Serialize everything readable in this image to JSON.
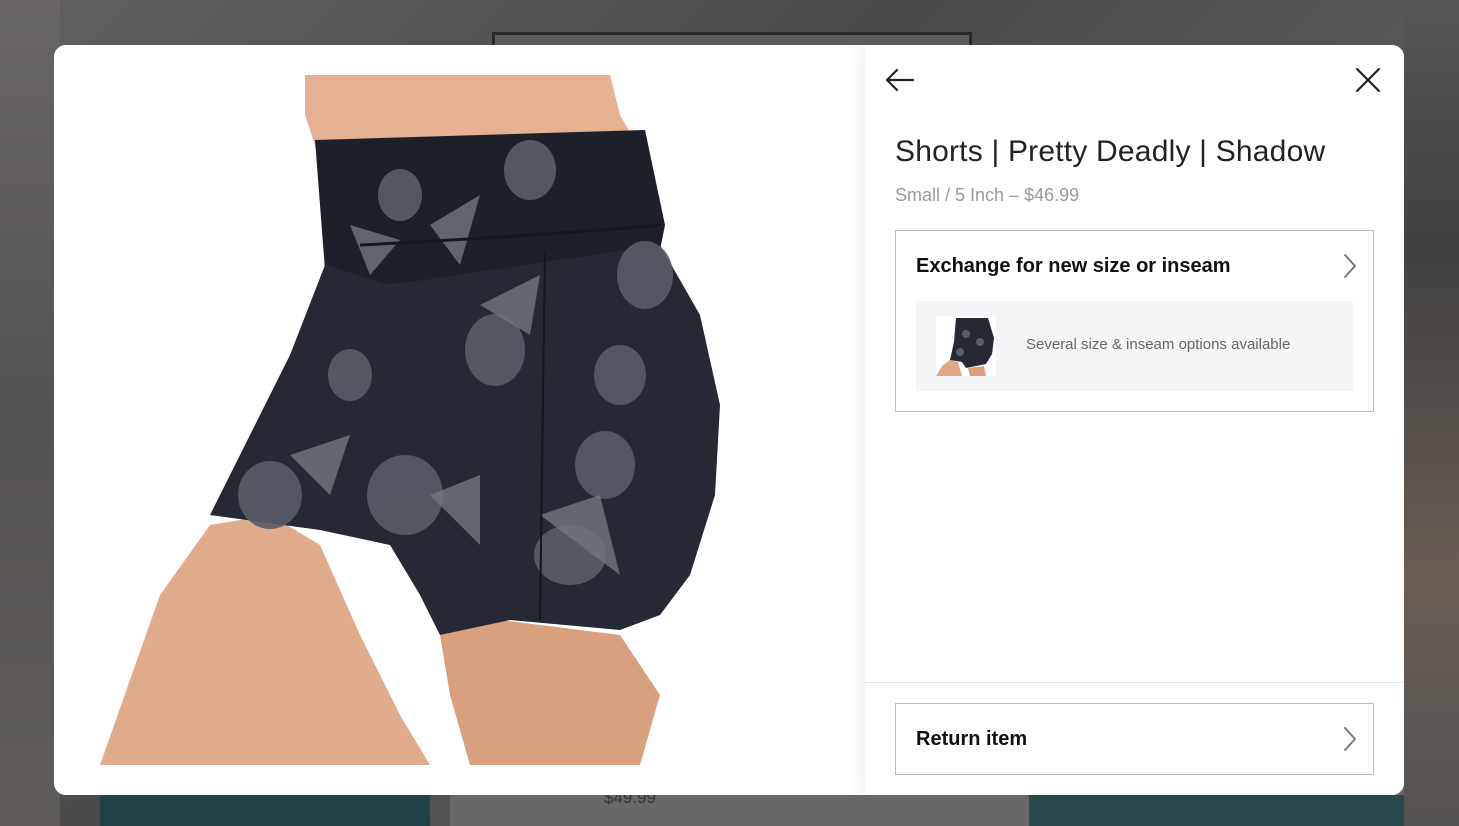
{
  "product": {
    "title": "Shorts | Pretty Deadly | Shadow",
    "variant": "Small / 5 Inch – $46.99"
  },
  "exchange_option": {
    "label": "Exchange for new size or inseam",
    "info": "Several size & inseam options available"
  },
  "return_option": {
    "label": "Return item"
  },
  "background": {
    "price": "$49.99"
  },
  "icons": {
    "back": "arrow-left-icon",
    "close": "close-icon",
    "chevron": "chevron-right-icon"
  },
  "colors": {
    "text": "#222222",
    "muted": "#9a9a9a",
    "border": "#bdbdbd",
    "info_bg": "#f4f5f7",
    "overlay": "#6b6b6b"
  }
}
